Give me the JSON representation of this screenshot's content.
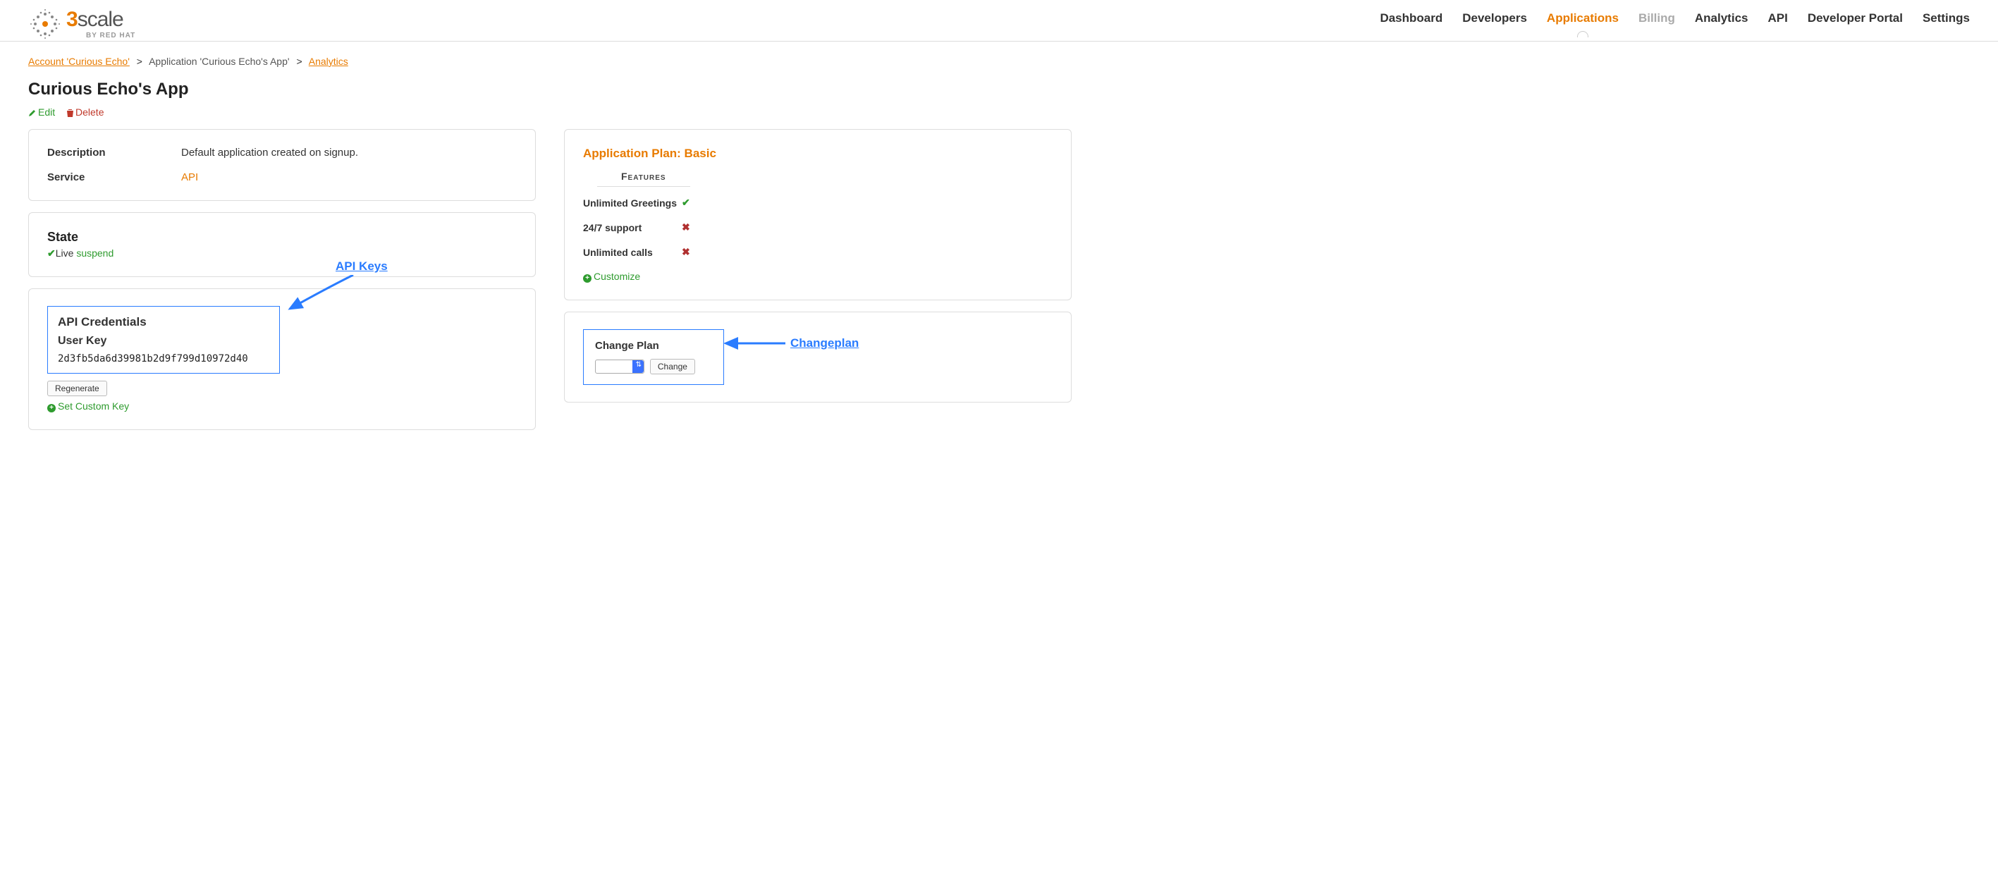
{
  "brand": {
    "name_a": "3",
    "name_b": "scale",
    "sub": "BY RED HAT"
  },
  "nav": {
    "items": [
      {
        "label": "Dashboard",
        "active": false,
        "disabled": false
      },
      {
        "label": "Developers",
        "active": false,
        "disabled": false
      },
      {
        "label": "Applications",
        "active": true,
        "disabled": false
      },
      {
        "label": "Billing",
        "active": false,
        "disabled": true
      },
      {
        "label": "Analytics",
        "active": false,
        "disabled": false
      },
      {
        "label": "API",
        "active": false,
        "disabled": false
      },
      {
        "label": "Developer Portal",
        "active": false,
        "disabled": false
      },
      {
        "label": "Settings",
        "active": false,
        "disabled": false
      }
    ]
  },
  "breadcrumb": {
    "account": "Account 'Curious Echo'",
    "current": "Application 'Curious Echo's App'",
    "tail": "Analytics"
  },
  "page": {
    "title": "Curious Echo's App",
    "edit": "Edit",
    "delete": "Delete"
  },
  "details": {
    "description_label": "Description",
    "description_value": "Default application created on signup.",
    "service_label": "Service",
    "service_value": "API"
  },
  "state": {
    "heading": "State",
    "value": "Live",
    "action": "suspend"
  },
  "credentials": {
    "heading": "API Credentials",
    "sub": "User Key",
    "key": "2d3fb5da6d39981b2d9f799d10972d40",
    "regenerate": "Regenerate",
    "set_custom": "Set Custom Key"
  },
  "plan": {
    "title": "Application Plan: Basic",
    "features_label": "Features",
    "features": [
      {
        "name": "Unlimited Greetings",
        "enabled": true
      },
      {
        "name": "24/7 support",
        "enabled": false
      },
      {
        "name": "Unlimited calls",
        "enabled": false
      }
    ],
    "customize": "Customize"
  },
  "change_plan": {
    "heading": "Change Plan",
    "button": "Change"
  },
  "annotations": {
    "api_keys": "API Keys",
    "changeplan": "Changeplan"
  }
}
